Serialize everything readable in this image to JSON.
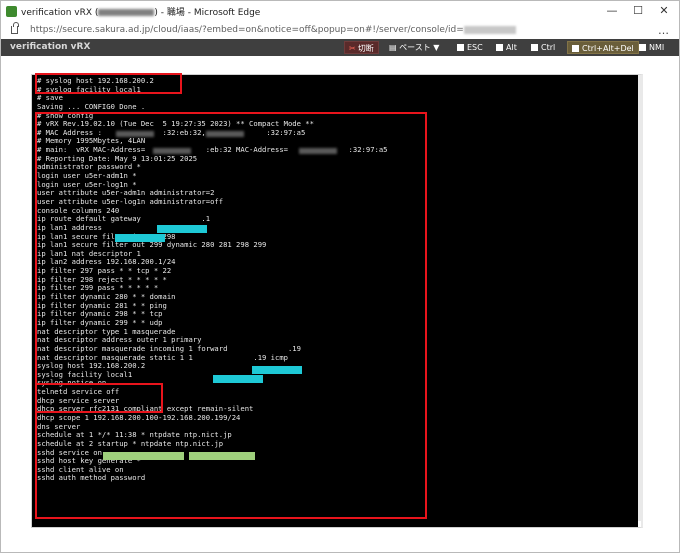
{
  "window": {
    "title": "verification vRX (",
    "title_tail": ") - 職場 - Microsoft Edge",
    "controls": {
      "minimize": "—",
      "maximize": "☐",
      "close": "✕"
    }
  },
  "address": {
    "url_prefix": "https://secure.sakura.ad.jp/cloud/iaas/?embed=on&notice=off&popup=on#!/server/console/id=",
    "more": "…"
  },
  "toolbar": {
    "app_title": "verification vRX",
    "cut_label": "切断",
    "paste_label": "ペースト ▼",
    "esc_label": "ESC",
    "alt_label": "Alt",
    "ctrl_label": "Ctrl",
    "ctrl_alt_del_label": "Ctrl+Alt+Del",
    "nmi_label": "NMI"
  },
  "terminal": {
    "lines": [
      "# syslog host 192.168.200.2",
      "# syslog facility local1",
      "# save",
      "Saving ... CONFIG0 Done .",
      "# show config",
      "# vRX Rev.19.02.10 (Tue Dec  5 19:27:35 2023) ** Compact Mode **",
      "# MAC Address :              :32:eb:32,              :32:97:a5",
      "# Memory 1995Mbytes, 4LAN",
      "# main:  vRX MAC-Address=              :eb:32 MAC-Address=              :32:97:a5",
      "# Reporting Date: May 9 13:01:25 2025",
      "administrator password *",
      "login user u5er-adm1n *",
      "login user u5er-log1n *",
      "user attribute u5er-adm1n administrator=2",
      "user attribute u5er-log1n administrator=off",
      "console columns 240",
      "ip route default gateway              .1",
      "ip lan1 address              .19/24",
      "ip lan1 secure filter in 297 298",
      "ip lan1 secure filter out 299 dynamic 280 281 298 299",
      "ip lan1 nat descriptor 1",
      "ip lan2 address 192.168.200.1/24",
      "ip filter 297 pass * * tcp * 22",
      "ip filter 298 reject * * * * *",
      "ip filter 299 pass * * * * *",
      "ip filter dynamic 280 * * domain",
      "ip filter dynamic 281 * * ping",
      "ip filter dynamic 298 * * tcp",
      "ip filter dynamic 299 * * udp",
      "nat descriptor type 1 masquerade",
      "nat descriptor address outer 1 primary",
      "nat descriptor masquerade incoming 1 forward              .19",
      "nat descriptor masquerade static 1 1              .19 icmp",
      "syslog host 192.168.200.2",
      "syslog facility local1",
      "syslog notice on",
      "telnetd service off",
      "dhcp service server",
      "dhcp server rfc2131 compliant except remain-silent",
      "dhcp scope 1 192.168.200.100-192.168.200.199/24",
      "dns server",
      "schedule at 1 */* 11:38 * ntpdate ntp.nict.jp",
      "schedule at 2 startup * ntpdate ntp.nict.jp",
      "sshd service on",
      "sshd host key generate *",
      "sshd client alive on",
      "sshd auth method password"
    ]
  },
  "colors": {
    "highlight_box": "#e8141c",
    "redaction_cyan": "#1ec9d6",
    "redaction_green": "#9fd07c",
    "toolbar_bg": "#3f3f3f"
  },
  "icons": [
    "app-icon",
    "lock-icon",
    "scissors-icon",
    "checkbox-icon"
  ]
}
